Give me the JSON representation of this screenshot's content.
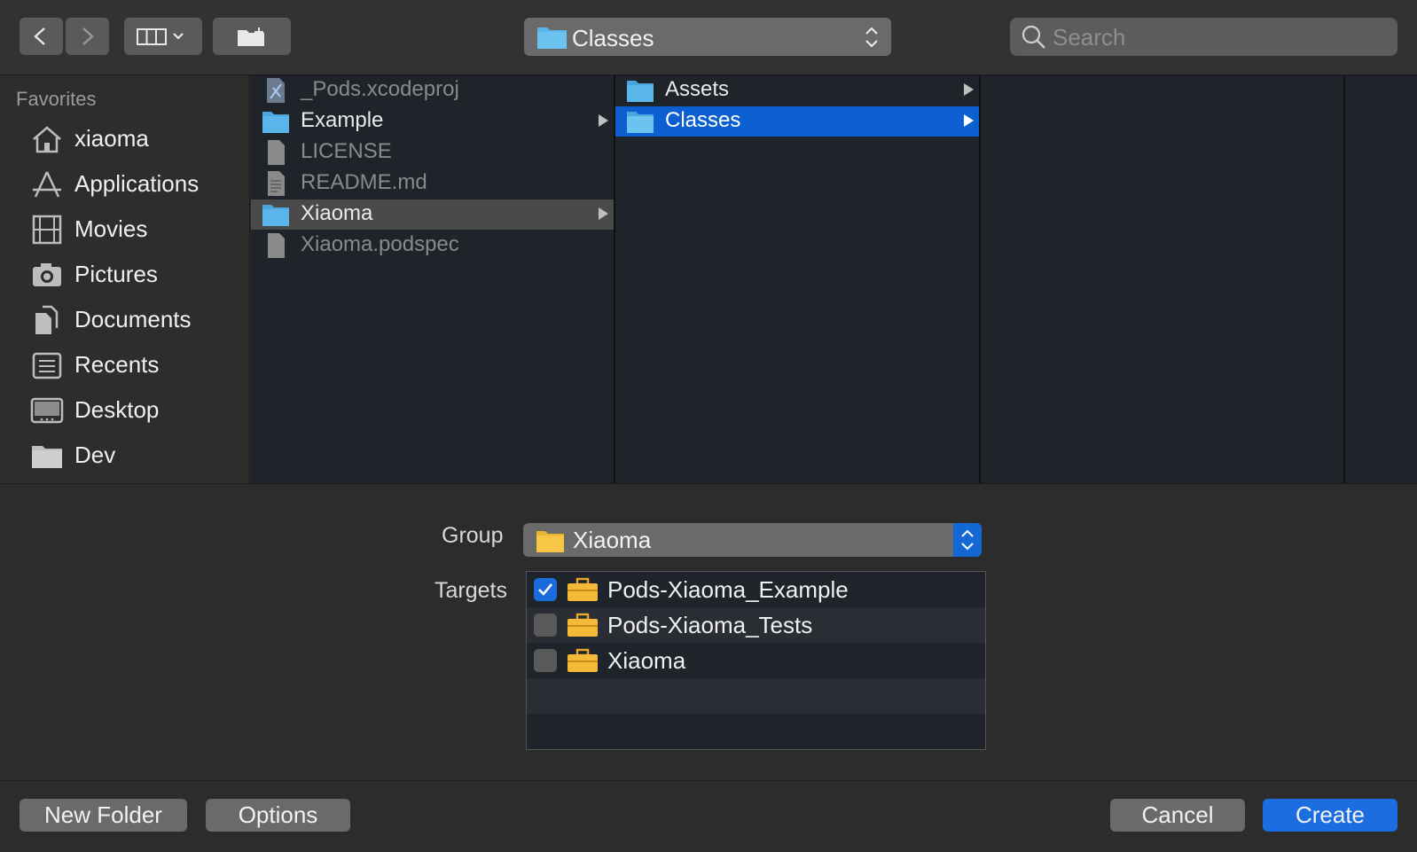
{
  "toolbar": {
    "location": "Classes",
    "search_placeholder": "Search"
  },
  "sidebar": {
    "heading": "Favorites",
    "items": [
      {
        "label": "xiaoma",
        "icon": "home-icon"
      },
      {
        "label": "Applications",
        "icon": "applications-icon"
      },
      {
        "label": "Movies",
        "icon": "film-icon"
      },
      {
        "label": "Pictures",
        "icon": "camera-icon"
      },
      {
        "label": "Documents",
        "icon": "documents-icon"
      },
      {
        "label": "Recents",
        "icon": "recents-icon"
      },
      {
        "label": "Desktop",
        "icon": "desktop-icon"
      },
      {
        "label": "Dev",
        "icon": "folder-icon"
      }
    ]
  },
  "columns": [
    {
      "items": [
        {
          "label": "_Pods.xcodeproj",
          "kind": "xcodeproj",
          "enabled": false
        },
        {
          "label": "Example",
          "kind": "folder",
          "enabled": true,
          "has_children": true
        },
        {
          "label": "LICENSE",
          "kind": "file",
          "enabled": false
        },
        {
          "label": "README.md",
          "kind": "text-file",
          "enabled": false
        },
        {
          "label": "Xiaoma",
          "kind": "folder",
          "enabled": true,
          "has_children": true,
          "selected": "inactive"
        },
        {
          "label": "Xiaoma.podspec",
          "kind": "file",
          "enabled": false
        }
      ]
    },
    {
      "items": [
        {
          "label": "Assets",
          "kind": "folder",
          "enabled": true,
          "has_children": true
        },
        {
          "label": "Classes",
          "kind": "folder",
          "enabled": true,
          "has_children": true,
          "selected": "active"
        }
      ]
    },
    {
      "items": []
    }
  ],
  "options": {
    "group_label": "Group",
    "group_value": "Xiaoma",
    "targets_label": "Targets",
    "targets": [
      {
        "label": "Pods-Xiaoma_Example",
        "checked": true
      },
      {
        "label": "Pods-Xiaoma_Tests",
        "checked": false
      },
      {
        "label": "Xiaoma",
        "checked": false
      }
    ]
  },
  "footer": {
    "new_folder": "New Folder",
    "options": "Options",
    "cancel": "Cancel",
    "create": "Create"
  },
  "colors": {
    "accent": "#0b5fd0",
    "folder": "#5ab6ea",
    "group_folder": "#f6c644"
  }
}
